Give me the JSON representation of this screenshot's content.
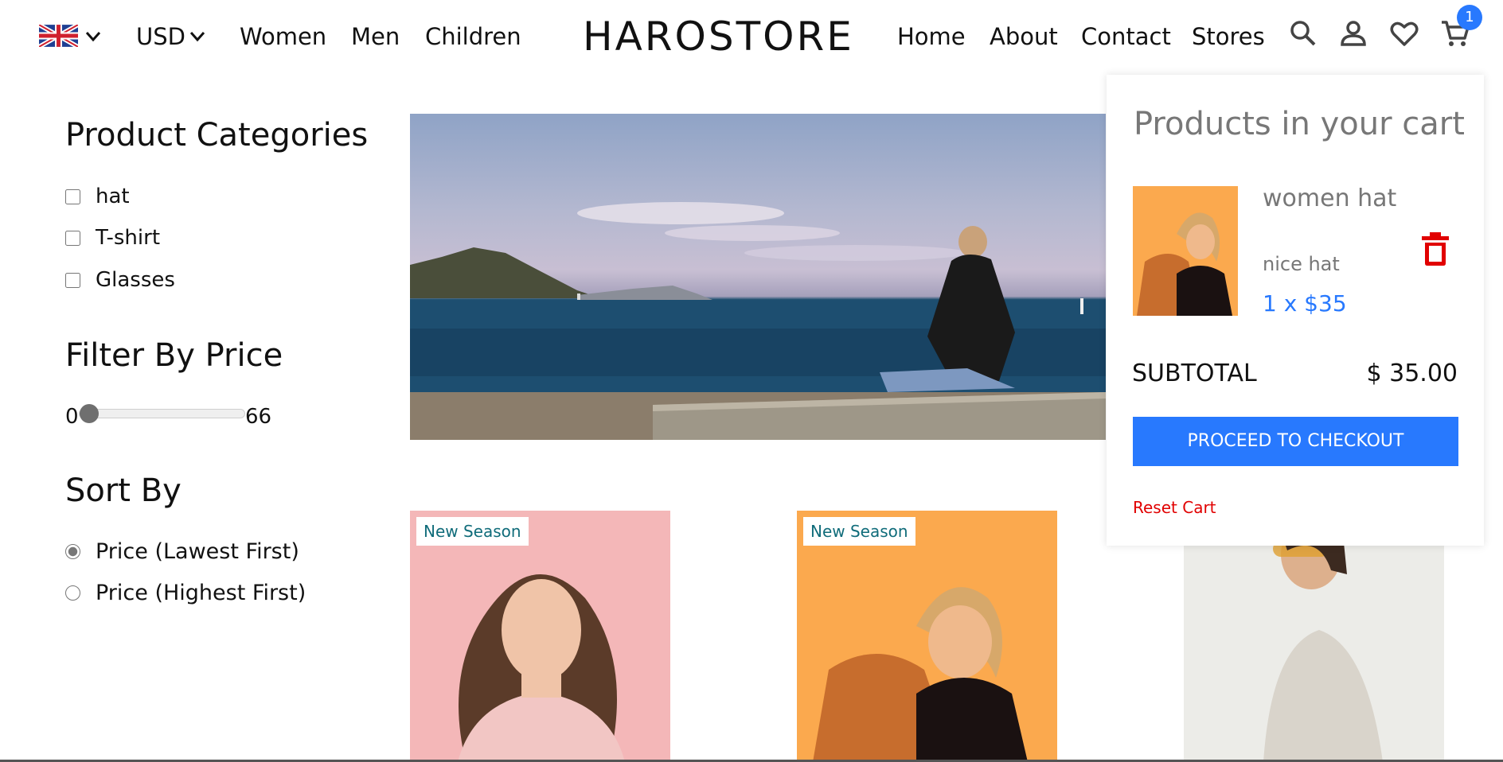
{
  "navbar": {
    "left_links": [
      "Women",
      "Men",
      "Children"
    ],
    "currency": "USD",
    "brand": "HAROSTORE",
    "right_links": [
      "Home",
      "About",
      "Contact",
      "Stores"
    ],
    "cart_count": "1",
    "icons": [
      "uk-flag-icon",
      "chevron-down-icon",
      "search-icon",
      "user-icon",
      "heart-icon",
      "cart-icon"
    ]
  },
  "sidebar": {
    "categories_title": "Product Categories",
    "categories": [
      {
        "label": "hat",
        "checked": false
      },
      {
        "label": "T-shirt",
        "checked": false
      },
      {
        "label": "Glasses",
        "checked": false
      }
    ],
    "price_title": "Filter By Price",
    "price_min": "0",
    "price_max": "66",
    "price_value": 0,
    "sort_title": "Sort By",
    "sort_options": [
      {
        "label": "Price (Lawest First)",
        "selected": true
      },
      {
        "label": "Price (Highest First)",
        "selected": false
      }
    ]
  },
  "products": [
    {
      "badge": "New Season"
    },
    {
      "badge": "New Season"
    },
    {
      "badge": ""
    }
  ],
  "cart": {
    "title": "Products in your cart",
    "items": [
      {
        "name": "women hat",
        "desc": "nice hat",
        "price": "1 x $35"
      }
    ],
    "subtotal_label": "SUBTOTAL",
    "subtotal_value": "$ 35.00",
    "checkout_label": "PROCEED TO CHECKOUT",
    "reset_label": "Reset Cart"
  },
  "colors": {
    "accent": "#2879fe",
    "danger": "#e10000",
    "badge_text": "#106c7a"
  }
}
